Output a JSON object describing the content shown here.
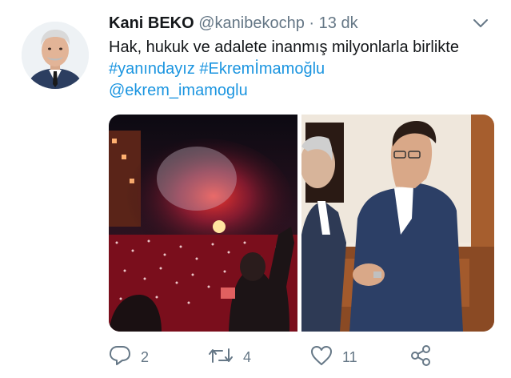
{
  "tweet": {
    "author_name": "Kani BEKO",
    "author_handle": "@kanibekochp",
    "separator": "·",
    "time": "13 dk",
    "text_plain": "Hak, hukuk ve adalete inanmış milyonlarla birlikte ",
    "hashtag1": "#yanındayız",
    "hashtag2": "#Ekremİmamoğlu",
    "mention": "@ekrem_imamoglu"
  },
  "actions": {
    "reply_count": "2",
    "retweet_count": "4",
    "like_count": "11"
  },
  "icons": {
    "caret": "chevron-down-icon",
    "reply": "reply-icon",
    "retweet": "retweet-icon",
    "like": "heart-icon",
    "share": "share-icon"
  },
  "colors": {
    "link": "#1b95e0",
    "muted": "#657786",
    "text": "#14171a"
  }
}
